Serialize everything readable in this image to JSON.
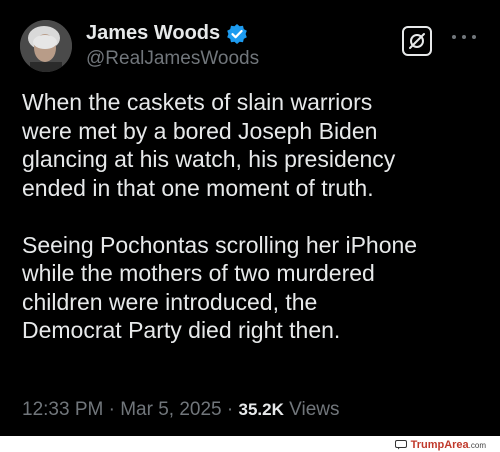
{
  "author": {
    "name": "James Woods",
    "handle": "@RealJamesWoods",
    "verified_color": "#1d9bf0"
  },
  "toolbar": {
    "grok_icon": "grok-icon",
    "more_icon": "more-icon"
  },
  "tweet": {
    "paragraph1": "When the caskets of slain warriors\nwere met by a bored Joseph Biden\nglancing at his watch, his presidency\nended in that one moment of truth.",
    "paragraph2": "Seeing Pochontas scrolling her iPhone\nwhile the mothers of two murdered\nchildren were introduced, the\nDemocrat Party died right then."
  },
  "meta": {
    "time": "12:33 PM",
    "separator": "·",
    "date": "Mar 5, 2025",
    "views_count": "35.2K",
    "views_label": "Views"
  },
  "watermark": {
    "brand": "TrumpArea",
    "suffix": ".com",
    "brand_color": "#c0392b"
  }
}
